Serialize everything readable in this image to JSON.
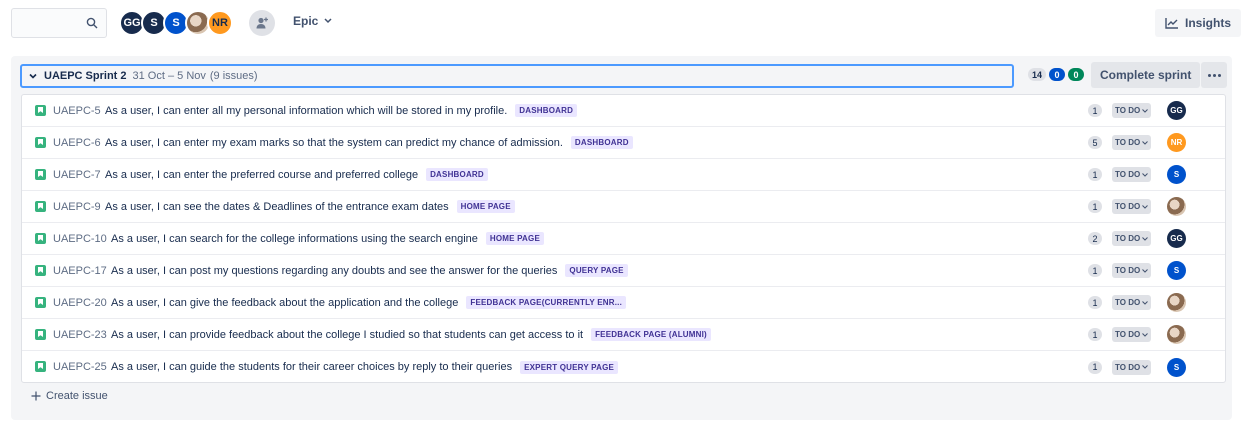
{
  "toolbar": {
    "search": {
      "value": "",
      "placeholder": ""
    },
    "avatars": [
      {
        "initials": "GG",
        "color": "#172b4d"
      },
      {
        "initials": "S",
        "color": "#172b4d"
      },
      {
        "initials": "S",
        "color": "#0052cc"
      },
      {
        "initials": "",
        "color": "photo"
      },
      {
        "initials": "NR",
        "color": "#ff991f"
      }
    ],
    "epic_label": "Epic",
    "insights_label": "Insights"
  },
  "sprint": {
    "name": "UAEPC Sprint 2",
    "dates": "31 Oct – 5 Nov",
    "issue_count": "(9 issues)",
    "counts": {
      "todo": "14",
      "in_progress": "0",
      "done": "0"
    },
    "complete_label": "Complete sprint"
  },
  "issues": [
    {
      "key": "UAEPC-5",
      "summary": "As a user, I can enter all my personal information which will be stored in my profile.",
      "epic": "DASHBOARD",
      "points": "1",
      "status": "TO DO",
      "assignee": "GG",
      "assignee_color": "navy"
    },
    {
      "key": "UAEPC-6",
      "summary": "As a user, I can enter my exam marks so that the system can predict my chance of admission.",
      "epic": "DASHBOARD",
      "points": "5",
      "status": "TO DO",
      "assignee": "NR",
      "assignee_color": "orange"
    },
    {
      "key": "UAEPC-7",
      "summary": "As a user, I can enter the preferred course and preferred college",
      "epic": "DASHBOARD",
      "points": "1",
      "status": "TO DO",
      "assignee": "S",
      "assignee_color": "blue"
    },
    {
      "key": "UAEPC-9",
      "summary": "As a user, I can see the dates & Deadlines of the entrance exam dates",
      "epic": "HOME PAGE",
      "points": "1",
      "status": "TO DO",
      "assignee": "",
      "assignee_color": "photo"
    },
    {
      "key": "UAEPC-10",
      "summary": "As a user, I can search for the college informations using the search engine",
      "epic": "HOME PAGE",
      "points": "2",
      "status": "TO DO",
      "assignee": "GG",
      "assignee_color": "navy"
    },
    {
      "key": "UAEPC-17",
      "summary": "As a user, I can post my questions regarding any doubts and see the answer for the queries",
      "epic": "QUERY PAGE",
      "points": "1",
      "status": "TO DO",
      "assignee": "S",
      "assignee_color": "blue"
    },
    {
      "key": "UAEPC-20",
      "summary": "As a user, I can give the feedback about the application and the college",
      "epic": "FEEDBACK PAGE(CURRENTLY ENR...",
      "points": "1",
      "status": "TO DO",
      "assignee": "",
      "assignee_color": "photo"
    },
    {
      "key": "UAEPC-23",
      "summary": "As a user, I can provide feedback about the college I studied so that students can get access to it",
      "epic": "FEEDBACK PAGE (ALUMNI)",
      "points": "1",
      "status": "TO DO",
      "assignee": "",
      "assignee_color": "photo"
    },
    {
      "key": "UAEPC-25",
      "summary": "As a user, I can guide the students for their career choices by reply to their queries",
      "epic": "EXPERT QUERY PAGE",
      "points": "1",
      "status": "TO DO",
      "assignee": "S",
      "assignee_color": "blue"
    }
  ],
  "create_label": "Create issue"
}
